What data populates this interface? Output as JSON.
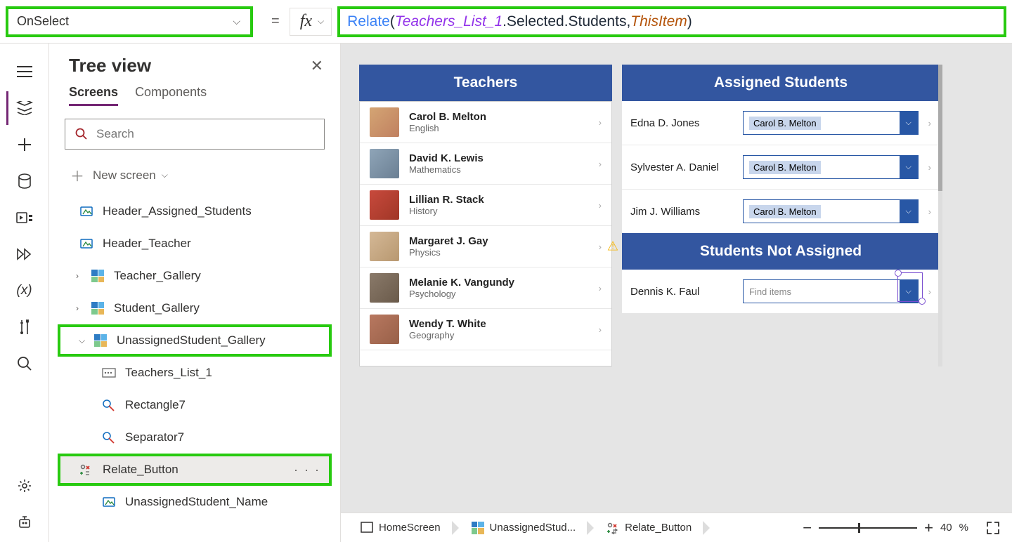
{
  "formula_bar": {
    "property": "OnSelect",
    "formula_tokens": [
      {
        "t": "fn",
        "v": "Relate"
      },
      {
        "t": "paren",
        "v": "("
      },
      {
        "t": "obj",
        "v": "Teachers_List_1"
      },
      {
        "t": "dot",
        "v": ".Selected.Students,"
      },
      {
        "t": "enum",
        "v": "ThisItem"
      },
      {
        "t": "paren",
        "v": ")"
      }
    ]
  },
  "tree": {
    "title": "Tree view",
    "tabs": {
      "screens": "Screens",
      "components": "Components"
    },
    "search_placeholder": "Search",
    "new_screen": "New screen",
    "items": [
      {
        "label": "Header_Assigned_Students",
        "type": "label",
        "indent": 1
      },
      {
        "label": "Header_Teacher",
        "type": "label",
        "indent": 1
      },
      {
        "label": "Teacher_Gallery",
        "type": "gallery",
        "indent": 0,
        "caret": "right"
      },
      {
        "label": "Student_Gallery",
        "type": "gallery",
        "indent": 0,
        "caret": "right"
      },
      {
        "label": "UnassignedStudent_Gallery",
        "type": "gallery",
        "indent": 0,
        "caret": "down",
        "hl": true
      },
      {
        "label": "Teachers_List_1",
        "type": "combo",
        "indent": 2
      },
      {
        "label": "Rectangle7",
        "type": "shape",
        "indent": 2
      },
      {
        "label": "Separator7",
        "type": "shape",
        "indent": 2
      },
      {
        "label": "Relate_Button",
        "type": "iconbtn",
        "indent": 2,
        "hl": true,
        "sel": true,
        "more": true
      },
      {
        "label": "UnassignedStudent_Name",
        "type": "label",
        "indent": 2
      }
    ]
  },
  "canvas": {
    "teachers_header": "Teachers",
    "assigned_header": "Assigned Students",
    "not_assigned_header": "Students Not Assigned",
    "teachers": [
      {
        "name": "Carol B. Melton",
        "subject": "English",
        "a": "a1"
      },
      {
        "name": "David K. Lewis",
        "subject": "Mathematics",
        "a": "a2"
      },
      {
        "name": "Lillian R. Stack",
        "subject": "History",
        "a": "a3"
      },
      {
        "name": "Margaret J. Gay",
        "subject": "Physics",
        "a": "a4",
        "warn": true
      },
      {
        "name": "Melanie K. Vangundy",
        "subject": "Psychology",
        "a": "a5"
      },
      {
        "name": "Wendy T. White",
        "subject": "Geography",
        "a": "a6"
      }
    ],
    "assigned": [
      {
        "name": "Edna D. Jones",
        "teacher": "Carol B. Melton"
      },
      {
        "name": "Sylvester A. Daniel",
        "teacher": "Carol B. Melton"
      },
      {
        "name": "Jim J. Williams",
        "teacher": "Carol B. Melton"
      }
    ],
    "unassigned": [
      {
        "name": "Dennis K. Faul",
        "teacher": "Find items"
      }
    ]
  },
  "status": {
    "crumb1": "HomeScreen",
    "crumb2": "UnassignedStud...",
    "crumb3": "Relate_Button",
    "zoom": "40",
    "zoom_unit": "%"
  }
}
